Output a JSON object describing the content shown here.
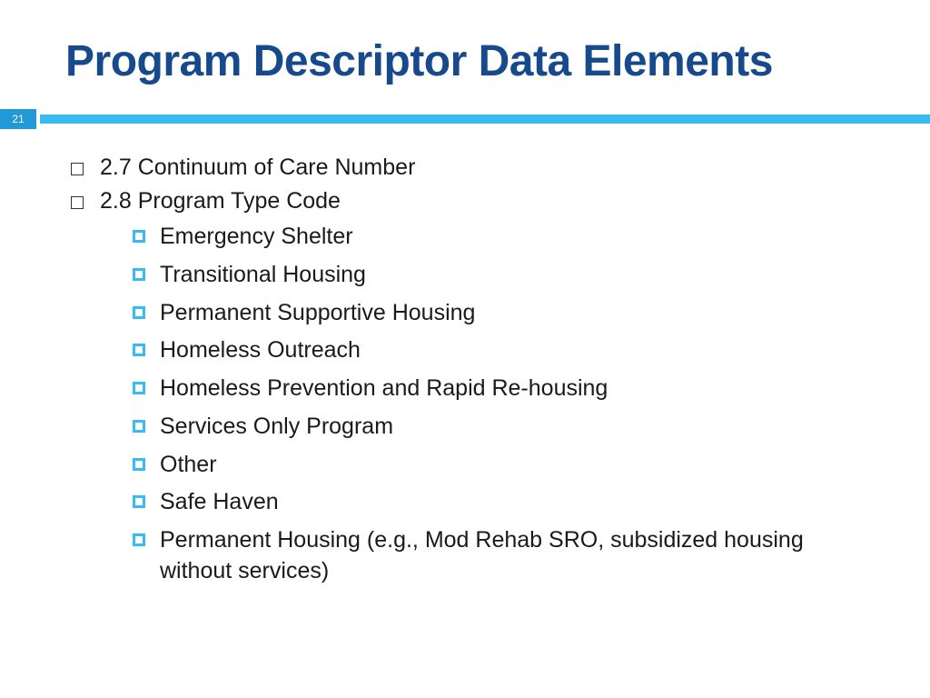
{
  "title": "Program Descriptor Data Elements",
  "page_number": "21",
  "items": [
    {
      "text": "2.7 Continuum of Care Number"
    },
    {
      "text": "2.8 Program Type Code",
      "subitems": [
        "Emergency Shelter",
        "Transitional Housing",
        "Permanent Supportive Housing",
        "Homeless Outreach",
        "Homeless Prevention and Rapid Re-housing",
        "Services Only Program",
        "Other",
        "Safe Haven",
        "Permanent Housing (e.g., Mod Rehab SRO, subsidized housing without services)"
      ]
    }
  ]
}
